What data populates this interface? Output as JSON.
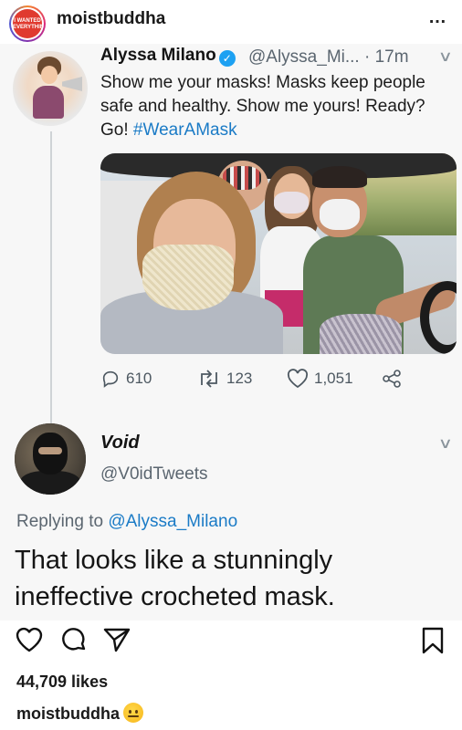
{
  "post": {
    "username": "moistbuddha",
    "avatar_text": [
      "I WANTED",
      "EVERYTHING"
    ],
    "more_icon": "…"
  },
  "tweet": {
    "name": "Alyssa Milano",
    "handle_time": "@Alyssa_Mi... · 17m",
    "text": "Show me your masks! Masks keep people safe and healthy. Show me yours! Ready? Go!",
    "hashtag": "#WearAMask",
    "replies": "610",
    "retweets": "123",
    "likes": "1,051"
  },
  "reply": {
    "name": "Void",
    "handle": "@V0idTweets",
    "replying_prefix": "Replying to",
    "replying_to": "@Alyssa_Milano",
    "text": "That looks like a stunningly ineffective crocheted mask."
  },
  "footer": {
    "likes": "44,709 likes",
    "caption_user": "moistbuddha"
  },
  "colors": {
    "link": "#1b7bc6",
    "verified": "#1da1f2",
    "muted": "#5b6670"
  },
  "icons": [
    "more-icon",
    "verified-icon",
    "chevron-down-icon",
    "reply-icon",
    "retweet-icon",
    "heart-icon",
    "share-icon",
    "like-icon",
    "comment-icon",
    "send-icon",
    "bookmark-icon",
    "thinking-emoji"
  ]
}
